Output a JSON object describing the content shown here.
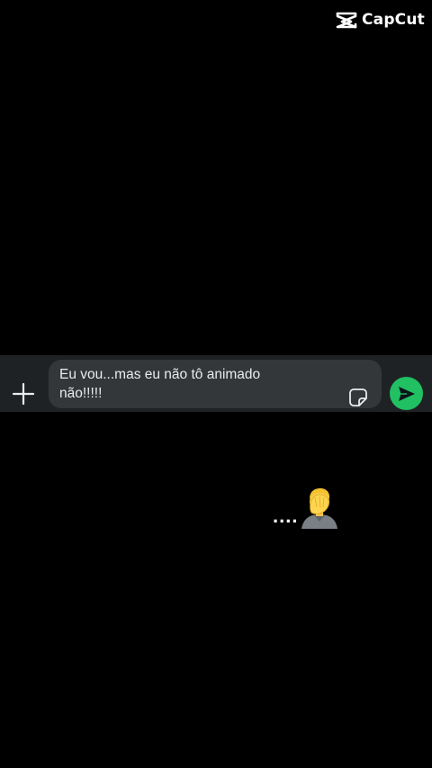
{
  "watermark": {
    "brand": "CapCut",
    "icon": "capcut-logo-icon"
  },
  "compose": {
    "message_text": "Eu vou...mas eu não tô animado\nnão!!!!!",
    "attach_icon": "plus-icon",
    "sticker_icon": "sticker-icon",
    "send_icon": "send-arrow-icon"
  },
  "overlay": {
    "dots": "....",
    "emoji_icon": "facepalm-emoji-icon"
  },
  "colors": {
    "background": "#000000",
    "compose_bar": "#1f2225",
    "input_pill": "#34373a",
    "send_accent": "#21c063",
    "text": "#e9edef"
  }
}
